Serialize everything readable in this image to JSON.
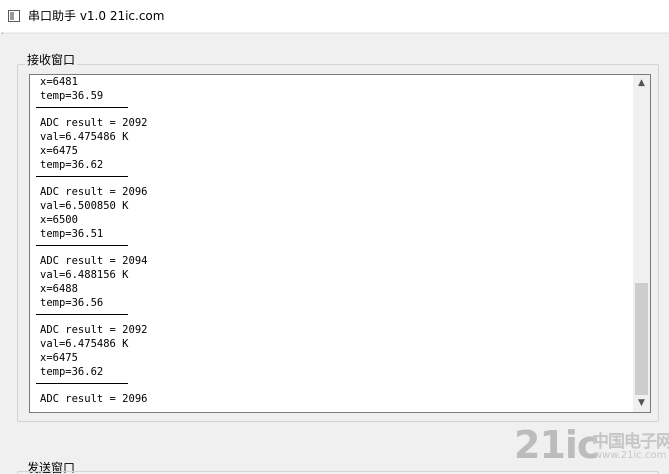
{
  "window": {
    "title": "串口助手 v1.0  21ic.com",
    "marker": "'"
  },
  "receive": {
    "label": "接收窗口",
    "blocks": [
      {
        "lines": [
          "x=6481",
          "temp=36.59"
        ]
      },
      {
        "lines": [
          "ADC result = 2092",
          "val=6.475486 K",
          "x=6475",
          "temp=36.62"
        ]
      },
      {
        "lines": [
          "ADC result = 2096",
          "val=6.500850 K",
          "x=6500",
          "temp=36.51"
        ]
      },
      {
        "lines": [
          "ADC result = 2094",
          "val=6.488156 K",
          "x=6488",
          "temp=36.56"
        ]
      },
      {
        "lines": [
          "ADC result = 2092",
          "val=6.475486 K",
          "x=6475",
          "temp=36.62"
        ]
      },
      {
        "lines": [
          "ADC result = 2096"
        ]
      }
    ]
  },
  "send": {
    "label": "发送窗口"
  },
  "scrollbar": {
    "up_icon": "scroll-up-arrow-icon",
    "down_icon": "scroll-down-arrow-icon",
    "up_glyph": "▲",
    "down_glyph": "▼"
  },
  "watermark": {
    "big": "21ic",
    "cn": "中国电子网",
    "url": "www.21ic.com"
  }
}
